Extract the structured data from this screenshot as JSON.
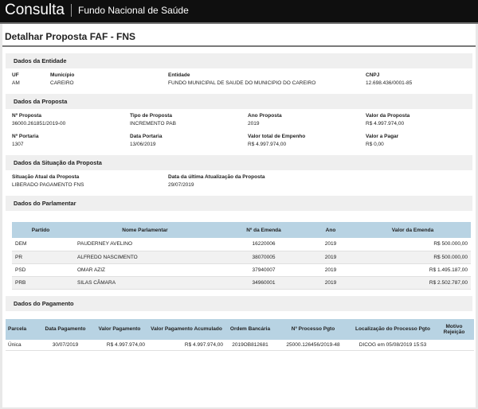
{
  "header": {
    "brand": "Consulta",
    "org": "Fundo Nacional de Saúde"
  },
  "page_title": "Detalhar Proposta FAF - FNS",
  "entidade": {
    "title": "Dados da Entidade",
    "fields": [
      {
        "label": "UF",
        "value": "AM"
      },
      {
        "label": "Município",
        "value": "CAREIRO"
      },
      {
        "label": "Entidade",
        "value": "FUNDO MUNICIPAL DE SAUDE DO MUNICIPIO DO CAREIRO"
      },
      {
        "label": "CNPJ",
        "value": "12.698.436/0001-85"
      }
    ]
  },
  "proposta": {
    "title": "Dados da Proposta",
    "fields": [
      {
        "label": "Nº Proposta",
        "value": "36000.261851/2019-00"
      },
      {
        "label": "Tipo de Proposta",
        "value": "INCREMENTO PAB"
      },
      {
        "label": "Ano Proposta",
        "value": "2019"
      },
      {
        "label": "Valor da Proposta",
        "value": "R$ 4.997.974,00"
      },
      {
        "label": "Nº Portaria",
        "value": "1307"
      },
      {
        "label": "Data Portaria",
        "value": "13/06/2019"
      },
      {
        "label": "Valor total de Empenho",
        "value": "R$ 4.997.974,00"
      },
      {
        "label": "Valor a Pagar",
        "value": "R$ 0,00"
      }
    ]
  },
  "situacao": {
    "title": "Dados da Situação da Proposta",
    "fields": [
      {
        "label": "Situação Atual da Proposta",
        "value": "LIBERADO PAGAMENTO FNS"
      },
      {
        "label": "Data da última Atualização da Proposta",
        "value": "29/07/2019"
      }
    ]
  },
  "parlamentar": {
    "title": "Dados do Parlamentar",
    "columns": [
      "Partido",
      "Nome Parlamentar",
      "Nº da Emenda",
      "Ano",
      "Valor da Emenda"
    ],
    "rows": [
      [
        "DEM",
        "PAUDERNEY AVELINO",
        "16220006",
        "2019",
        "R$ 500.000,00"
      ],
      [
        "PR",
        "ALFREDO NASCIMENTO",
        "38070005",
        "2019",
        "R$ 500.000,00"
      ],
      [
        "PSD",
        "OMAR AZIZ",
        "37940007",
        "2019",
        "R$ 1.495.187,00"
      ],
      [
        "PRB",
        "SILAS CÂMARA",
        "34960001",
        "2019",
        "R$ 2.502.787,00"
      ]
    ]
  },
  "pagamento": {
    "title": "Dados do Pagamento",
    "columns": [
      "Parcela",
      "Data Pagamento",
      "Valor Pagamento",
      "Valor Pagamento Acumulado",
      "Ordem Bancária",
      "Nº Processo Pgto",
      "Localização do Processo Pgto",
      "Motivo Rejeição"
    ],
    "rows": [
      [
        "Única",
        "30/07/2019",
        "R$ 4.997.974,00",
        "R$ 4.997.974,00",
        "2019OB812681",
        "25000.126456/2019-48",
        "DICOG em 05/08/2019 15:53",
        ""
      ]
    ]
  }
}
